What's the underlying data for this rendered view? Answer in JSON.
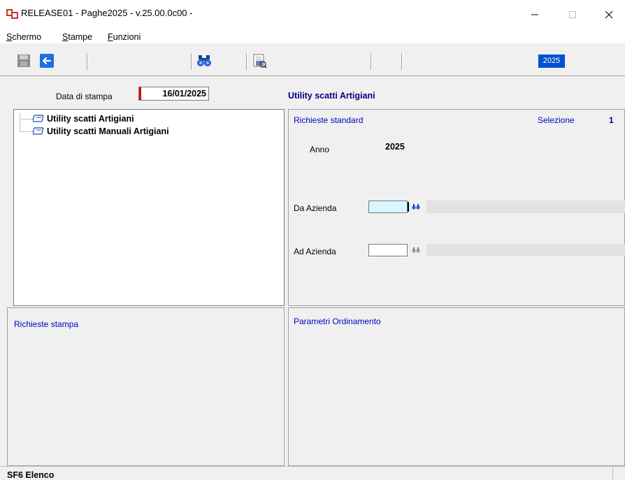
{
  "window": {
    "title": "RELEASE01 - Paghe2025 - v.25.00.0c00 -"
  },
  "menu": {
    "items": [
      {
        "label": "Schermo",
        "mnemonic": "S",
        "rest": "chermo"
      },
      {
        "label": "Stampe",
        "mnemonic": "S",
        "rest": "tampe"
      },
      {
        "label": "Funzioni",
        "mnemonic": "F",
        "rest": "unzioni"
      }
    ]
  },
  "toolbar": {
    "icons": [
      "save-icon",
      "back-arrow-icon",
      "binoculars-icon",
      "print-preview-icon"
    ],
    "year": "2025"
  },
  "header": {
    "print_date_label": "Data di stampa",
    "print_date_value": "16/01/2025",
    "section_title": "Utility scatti Artigiani"
  },
  "tree": {
    "items": [
      {
        "label": "Utility scatti Artigiani"
      },
      {
        "label": "Utility scatti Manuali Artigiani"
      }
    ]
  },
  "standard_requests": {
    "caption": "Richieste standard",
    "selection_label": "Selezione",
    "selection_value": "1",
    "year_label": "Anno",
    "year_value": "2025",
    "from_company_label": "Da Azienda",
    "from_company_value": "",
    "to_company_label": "Ad Azienda",
    "to_company_value": ""
  },
  "print_requests": {
    "caption": "Richieste stampa"
  },
  "order_params": {
    "caption": "Parametri Ordinamento"
  },
  "status": {
    "text": "SF6 Elenco"
  },
  "colors": {
    "accent_blue": "#0050d0",
    "caption_blue": "#0000c0",
    "title_navy": "#000080",
    "required_red": "#e00000",
    "active_input": "#d8f6ff"
  }
}
